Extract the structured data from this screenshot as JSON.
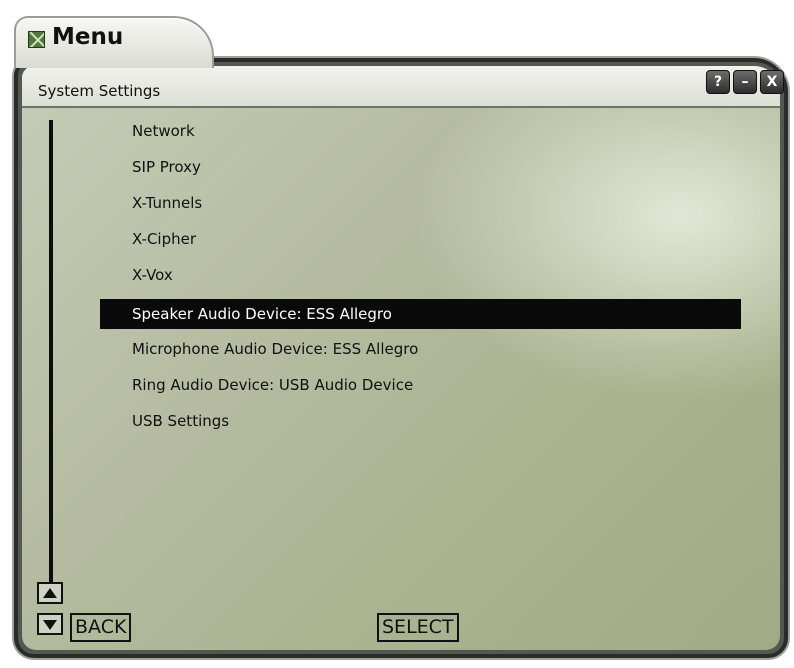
{
  "app": {
    "title": "Menu"
  },
  "section": {
    "title": "System Settings"
  },
  "window_buttons": {
    "help": "?",
    "minimize": "–",
    "close": "X"
  },
  "menu": {
    "items": [
      {
        "label": "Network"
      },
      {
        "label": "SIP Proxy"
      },
      {
        "label": "X-Tunnels"
      },
      {
        "label": "X-Cipher"
      },
      {
        "label": "X-Vox"
      },
      {
        "label": "Speaker Audio Device: ESS Allegro",
        "selected": true
      },
      {
        "label": "Microphone Audio Device: ESS Allegro"
      },
      {
        "label": "Ring Audio Device: USB Audio Device"
      },
      {
        "label": "USB Settings"
      }
    ]
  },
  "footer": {
    "back_label": "BACK",
    "select_label": "SELECT"
  },
  "icons": {
    "app": "menu-app-icon",
    "scroll_up": "triangle-up-icon",
    "scroll_down": "triangle-down-icon"
  },
  "colors": {
    "panel": "#b7bca3",
    "selection_bg": "#0a0a0a",
    "selection_text": "#ffffff",
    "frame": "#2a2c28"
  }
}
